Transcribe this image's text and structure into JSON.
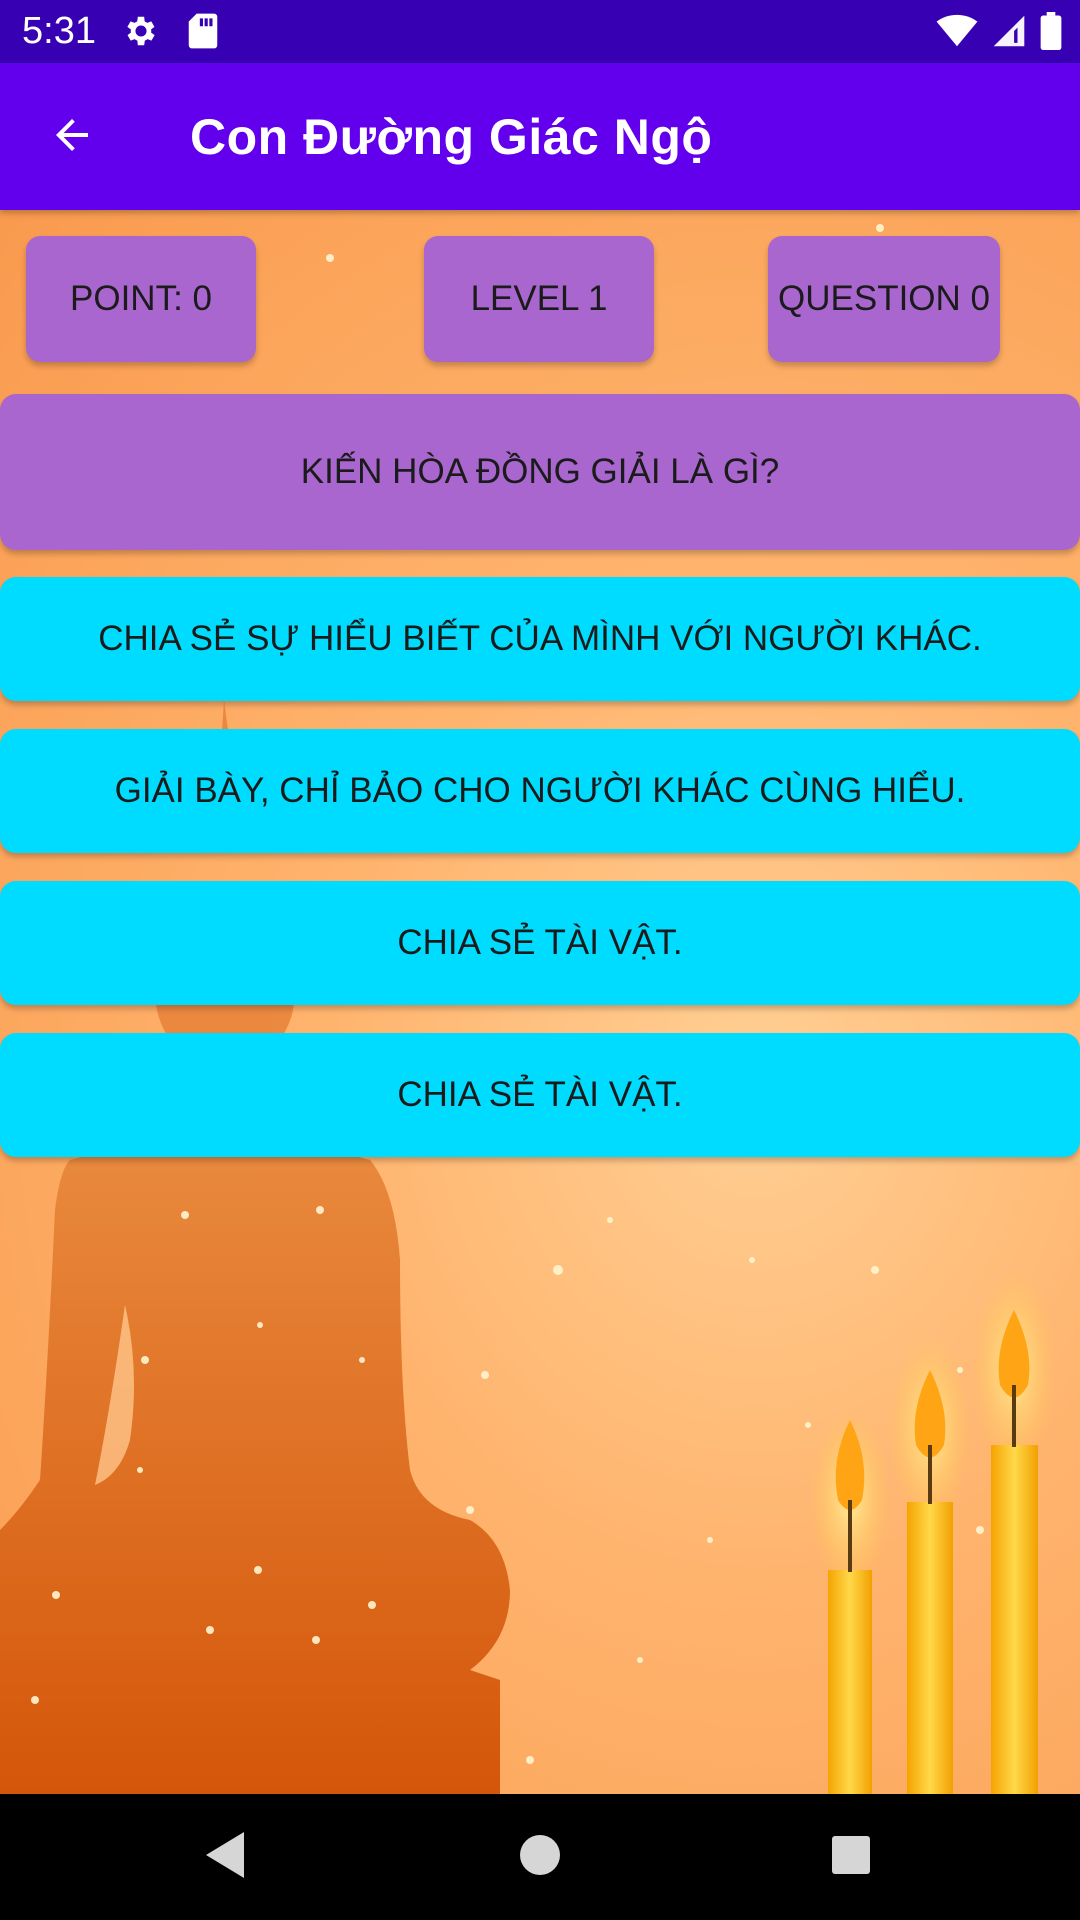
{
  "status_bar": {
    "time": "5:31",
    "icons_left": [
      "settings-icon",
      "sd-card-icon"
    ],
    "icons_right": [
      "wifi-icon",
      "cell-signal-icon",
      "battery-icon"
    ],
    "background": "#3700b3"
  },
  "app_bar": {
    "title": "Con Đường Giác Ngộ",
    "back_icon": "arrow-back-icon",
    "background": "#6200ee"
  },
  "stats": {
    "point": "POINT: 0",
    "level": "LEVEL 1",
    "question": "QUESTION 0"
  },
  "question": {
    "text": "KIẾN HÒA ĐỒNG GIẢI LÀ GÌ?"
  },
  "answers": [
    {
      "label": "CHIA SẺ SỰ HIỂU BIẾT CỦA MÌNH VỚI NGƯỜI KHÁC."
    },
    {
      "label": "GIẢI BÀY, CHỈ BẢO CHO NGƯỜI KHÁC CÙNG HIỂU."
    },
    {
      "label": "CHIA SẺ TÀI VẬT."
    },
    {
      "label": "CHIA SẺ TÀI VẬT."
    }
  ],
  "colors": {
    "chip": "#a966cf",
    "answer": "#00dcff",
    "background": "#ffb46e"
  },
  "nav_bar": {
    "icons": [
      "back-triangle-icon",
      "home-circle-icon",
      "recents-square-icon"
    ]
  }
}
